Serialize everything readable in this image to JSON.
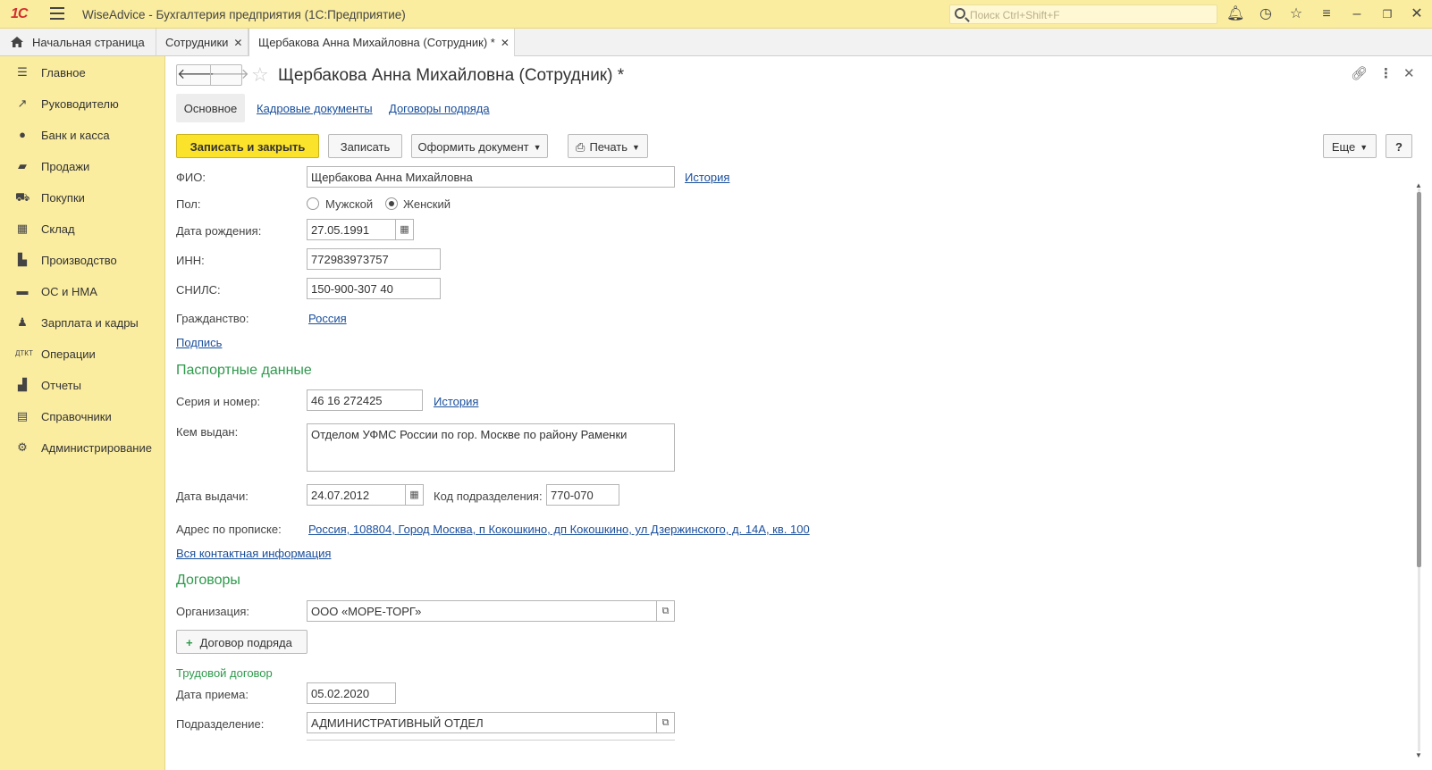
{
  "app": {
    "logo": "1С",
    "title": "WiseAdvice - Бухгалтерия предприятия  (1С:Предприятие)",
    "search_placeholder": "Поиск Ctrl+Shift+F"
  },
  "tabs": [
    {
      "label": "Начальная страница"
    },
    {
      "label": "Сотрудники"
    },
    {
      "label": "Щербакова Анна Михайловна (Сотрудник) *"
    }
  ],
  "sidebar": {
    "items": [
      {
        "label": "Главное",
        "icon": "menu-lines-icon"
      },
      {
        "label": "Руководителю",
        "icon": "trend-icon"
      },
      {
        "label": "Банк и касса",
        "icon": "coin-icon"
      },
      {
        "label": "Продажи",
        "icon": "bag-icon"
      },
      {
        "label": "Покупки",
        "icon": "cart-icon"
      },
      {
        "label": "Склад",
        "icon": "grid-icon"
      },
      {
        "label": "Производство",
        "icon": "factory-icon"
      },
      {
        "label": "ОС и НМА",
        "icon": "truck-icon"
      },
      {
        "label": "Зарплата и кадры",
        "icon": "person-icon"
      },
      {
        "label": "Операции",
        "icon": "dt-kt-icon"
      },
      {
        "label": "Отчеты",
        "icon": "bar-chart-icon"
      },
      {
        "label": "Справочники",
        "icon": "books-icon"
      },
      {
        "label": "Администрирование",
        "icon": "gear-icon"
      }
    ]
  },
  "form": {
    "title": "Щербакова Анна Михайловна (Сотрудник) *",
    "subtabs": {
      "main": "Основное",
      "hr_docs": "Кадровые документы",
      "contracts": "Договоры подряда"
    },
    "buttons": {
      "save_close": "Записать и закрыть",
      "save": "Записать",
      "make_doc": "Оформить документ",
      "print": "Печать",
      "more": "Еще",
      "help": "?"
    },
    "fio_label": "ФИО:",
    "fio_value": "Щербакова Анна Михайловна",
    "history": "История",
    "gender_label": "Пол:",
    "gender_male": "Мужской",
    "gender_female": "Женский",
    "gender_selected": "Женский",
    "birth_label": "Дата рождения:",
    "birth_value": "27.05.1991",
    "inn_label": "ИНН:",
    "inn_value": "772983973757",
    "snils_label": "СНИЛС:",
    "snils_value": "150-900-307 40",
    "citizenship_label": "Гражданство:",
    "citizenship_value": "Россия",
    "signature_link": "Подпись",
    "passport_section": "Паспортные данные",
    "series_label": "Серия и номер:",
    "series_value": "46 16 272425",
    "series_history": "История",
    "issued_by_label": "Кем выдан:",
    "issued_by_value": "Отделом УФМС России по гор. Москве по району Раменки",
    "issue_date_label": "Дата выдачи:",
    "issue_date_value": "24.07.2012",
    "dept_code_label": "Код подразделения:",
    "dept_code_value": "770-070",
    "address_label": "Адрес по прописке:",
    "address_value": "Россия, 108804, Город Москва, п Кокошкино, дп Кокошкино, ул Дзержинского, д. 14А, кв. 100",
    "all_contacts_link": "Вся контактная информация",
    "contracts_section": "Договоры",
    "org_label": "Организация:",
    "org_value": "ООО «МОРЕ-ТОРГ»",
    "add_contract_btn": "Договор подряда",
    "employment_section": "Трудовой договор",
    "hire_date_label": "Дата приема:",
    "hire_date_value": "05.02.2020",
    "division_label": "Подразделение:",
    "division_value": "АДМИНИСТРАТИВНЫЙ ОТДЕЛ"
  }
}
